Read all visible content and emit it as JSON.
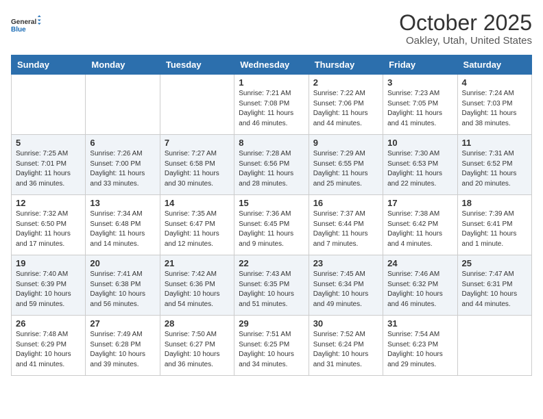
{
  "header": {
    "logo_line1": "General",
    "logo_line2": "Blue",
    "month_title": "October 2025",
    "location": "Oakley, Utah, United States"
  },
  "days_of_week": [
    "Sunday",
    "Monday",
    "Tuesday",
    "Wednesday",
    "Thursday",
    "Friday",
    "Saturday"
  ],
  "weeks": [
    [
      {
        "day": "",
        "info": ""
      },
      {
        "day": "",
        "info": ""
      },
      {
        "day": "",
        "info": ""
      },
      {
        "day": "1",
        "info": "Sunrise: 7:21 AM\nSunset: 7:08 PM\nDaylight: 11 hours\nand 46 minutes."
      },
      {
        "day": "2",
        "info": "Sunrise: 7:22 AM\nSunset: 7:06 PM\nDaylight: 11 hours\nand 44 minutes."
      },
      {
        "day": "3",
        "info": "Sunrise: 7:23 AM\nSunset: 7:05 PM\nDaylight: 11 hours\nand 41 minutes."
      },
      {
        "day": "4",
        "info": "Sunrise: 7:24 AM\nSunset: 7:03 PM\nDaylight: 11 hours\nand 38 minutes."
      }
    ],
    [
      {
        "day": "5",
        "info": "Sunrise: 7:25 AM\nSunset: 7:01 PM\nDaylight: 11 hours\nand 36 minutes."
      },
      {
        "day": "6",
        "info": "Sunrise: 7:26 AM\nSunset: 7:00 PM\nDaylight: 11 hours\nand 33 minutes."
      },
      {
        "day": "7",
        "info": "Sunrise: 7:27 AM\nSunset: 6:58 PM\nDaylight: 11 hours\nand 30 minutes."
      },
      {
        "day": "8",
        "info": "Sunrise: 7:28 AM\nSunset: 6:56 PM\nDaylight: 11 hours\nand 28 minutes."
      },
      {
        "day": "9",
        "info": "Sunrise: 7:29 AM\nSunset: 6:55 PM\nDaylight: 11 hours\nand 25 minutes."
      },
      {
        "day": "10",
        "info": "Sunrise: 7:30 AM\nSunset: 6:53 PM\nDaylight: 11 hours\nand 22 minutes."
      },
      {
        "day": "11",
        "info": "Sunrise: 7:31 AM\nSunset: 6:52 PM\nDaylight: 11 hours\nand 20 minutes."
      }
    ],
    [
      {
        "day": "12",
        "info": "Sunrise: 7:32 AM\nSunset: 6:50 PM\nDaylight: 11 hours\nand 17 minutes."
      },
      {
        "day": "13",
        "info": "Sunrise: 7:34 AM\nSunset: 6:48 PM\nDaylight: 11 hours\nand 14 minutes."
      },
      {
        "day": "14",
        "info": "Sunrise: 7:35 AM\nSunset: 6:47 PM\nDaylight: 11 hours\nand 12 minutes."
      },
      {
        "day": "15",
        "info": "Sunrise: 7:36 AM\nSunset: 6:45 PM\nDaylight: 11 hours\nand 9 minutes."
      },
      {
        "day": "16",
        "info": "Sunrise: 7:37 AM\nSunset: 6:44 PM\nDaylight: 11 hours\nand 7 minutes."
      },
      {
        "day": "17",
        "info": "Sunrise: 7:38 AM\nSunset: 6:42 PM\nDaylight: 11 hours\nand 4 minutes."
      },
      {
        "day": "18",
        "info": "Sunrise: 7:39 AM\nSunset: 6:41 PM\nDaylight: 11 hours\nand 1 minute."
      }
    ],
    [
      {
        "day": "19",
        "info": "Sunrise: 7:40 AM\nSunset: 6:39 PM\nDaylight: 10 hours\nand 59 minutes."
      },
      {
        "day": "20",
        "info": "Sunrise: 7:41 AM\nSunset: 6:38 PM\nDaylight: 10 hours\nand 56 minutes."
      },
      {
        "day": "21",
        "info": "Sunrise: 7:42 AM\nSunset: 6:36 PM\nDaylight: 10 hours\nand 54 minutes."
      },
      {
        "day": "22",
        "info": "Sunrise: 7:43 AM\nSunset: 6:35 PM\nDaylight: 10 hours\nand 51 minutes."
      },
      {
        "day": "23",
        "info": "Sunrise: 7:45 AM\nSunset: 6:34 PM\nDaylight: 10 hours\nand 49 minutes."
      },
      {
        "day": "24",
        "info": "Sunrise: 7:46 AM\nSunset: 6:32 PM\nDaylight: 10 hours\nand 46 minutes."
      },
      {
        "day": "25",
        "info": "Sunrise: 7:47 AM\nSunset: 6:31 PM\nDaylight: 10 hours\nand 44 minutes."
      }
    ],
    [
      {
        "day": "26",
        "info": "Sunrise: 7:48 AM\nSunset: 6:29 PM\nDaylight: 10 hours\nand 41 minutes."
      },
      {
        "day": "27",
        "info": "Sunrise: 7:49 AM\nSunset: 6:28 PM\nDaylight: 10 hours\nand 39 minutes."
      },
      {
        "day": "28",
        "info": "Sunrise: 7:50 AM\nSunset: 6:27 PM\nDaylight: 10 hours\nand 36 minutes."
      },
      {
        "day": "29",
        "info": "Sunrise: 7:51 AM\nSunset: 6:25 PM\nDaylight: 10 hours\nand 34 minutes."
      },
      {
        "day": "30",
        "info": "Sunrise: 7:52 AM\nSunset: 6:24 PM\nDaylight: 10 hours\nand 31 minutes."
      },
      {
        "day": "31",
        "info": "Sunrise: 7:54 AM\nSunset: 6:23 PM\nDaylight: 10 hours\nand 29 minutes."
      },
      {
        "day": "",
        "info": ""
      }
    ]
  ]
}
